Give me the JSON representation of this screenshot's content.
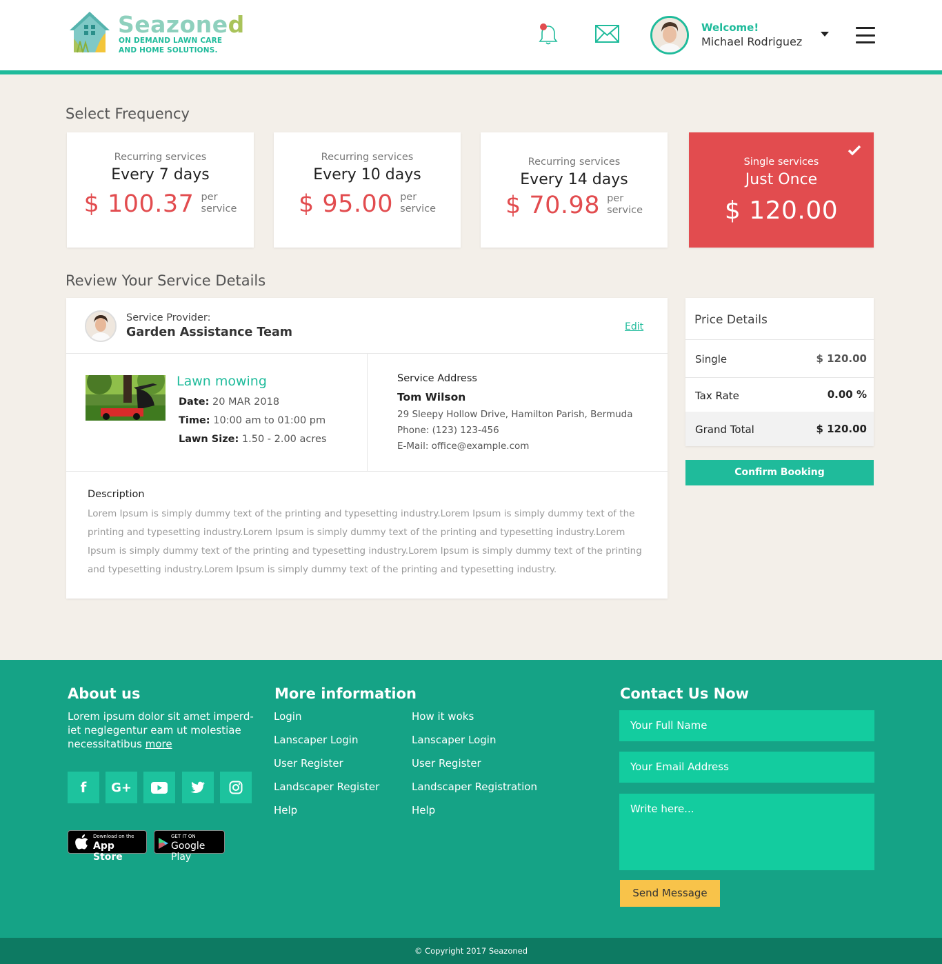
{
  "brand": {
    "name_prefix": "Seazone",
    "name_suffix": "d",
    "tagline_1": "ON DEMAND LAWN CARE",
    "tagline_2": "AND HOME SOLUTIONS."
  },
  "header": {
    "welcome": "Welcome!",
    "user_name": "Michael Rodriguez",
    "icons": [
      "bell-icon",
      "mail-icon",
      "avatar",
      "dropdown-caret-icon",
      "hamburger-menu-icon"
    ]
  },
  "frequency": {
    "title": "Select Frequency",
    "options": [
      {
        "sub": "Recurring services",
        "title": "Every 7 days",
        "amount": "$ 100.37",
        "per_1": "per",
        "per_2": "service",
        "selected": false
      },
      {
        "sub": "Recurring services",
        "title": "Every 10 days",
        "amount": "$ 95.00",
        "per_1": "per",
        "per_2": "service",
        "selected": false
      },
      {
        "sub": "Recurring services",
        "title": "Every 14 days",
        "amount": "$ 70.98",
        "per_1": "per",
        "per_2": "service",
        "selected": false
      },
      {
        "sub": "Single services",
        "title": "Just Once",
        "amount": "$ 120.00",
        "selected": true
      }
    ]
  },
  "review": {
    "title": "Review Your Service Details",
    "provider_label": "Service Provider:",
    "provider_name": "Garden Assistance Team",
    "edit": "Edit",
    "service": {
      "name": "Lawn mowing",
      "date_label": "Date:",
      "date": "20 MAR 2018",
      "time_label": "Time:",
      "time": "10:00 am to 01:00 pm",
      "size_label": "Lawn Size:",
      "size": "1.50 - 2.00 acres"
    },
    "address": {
      "heading": "Service Address",
      "name": "Tom Wilson",
      "street": "29 Sleepy Hollow Drive, Hamilton Parish, Bermuda",
      "phone": "Phone: (123) 123-456",
      "email": "E-Mail: office@example.com"
    },
    "description_heading": "Description",
    "description": "Lorem Ipsum is simply dummy text of the printing and typesetting industry.Lorem Ipsum is simply dummy text of the printing and typesetting industry.Lorem Ipsum is simply dummy text of the printing and typesetting industry.Lorem Ipsum is simply dummy text of the printing and typesetting industry.Lorem Ipsum is simply dummy text of the printing and typesetting industry.Lorem Ipsum is simply dummy text of the printing and typesetting industry."
  },
  "price": {
    "title": "Price Details",
    "rows": [
      {
        "label": "Single",
        "value": "$ 120.00"
      },
      {
        "label": "Tax Rate",
        "value": "0.00 %"
      },
      {
        "label": "Grand Total",
        "value": "$ 120.00"
      }
    ],
    "confirm": "Confirm Booking"
  },
  "footer": {
    "about_title": "About us",
    "about_text": "Lorem ipsum dolor sit amet imperd-iet neglegentur eam ut molestiae necessitatibus",
    "about_more": "more",
    "social": [
      "facebook-icon",
      "google-plus-icon",
      "youtube-icon",
      "twitter-icon",
      "instagram-icon"
    ],
    "social_glyphs": [
      "f",
      "G+",
      "▶",
      "t",
      "◎"
    ],
    "app_store_small": "Download on the",
    "app_store_big": "App Store",
    "google_play_small": "GET IT ON",
    "google_play_big": "Google Play",
    "more_title": "More information",
    "links_col1": [
      "Login",
      "Lanscaper Login",
      "User Register",
      "Landscaper Register",
      "Help"
    ],
    "links_col2": [
      "How it woks",
      "Lanscaper Login",
      "User Register",
      "Landscaper Registration",
      "Help"
    ],
    "contact_title": "Contact Us Now",
    "name_placeholder": "Your Full Name",
    "email_placeholder": "Your Email Address",
    "message_placeholder": "Write here...",
    "send": "Send Message",
    "copyright": "© Copyright 2017 Seazoned"
  },
  "colors": {
    "accent": "#1fbb9b",
    "price_red": "#e24c4f",
    "footer_bg": "#15a386",
    "input_bg": "#13cc9f",
    "send_button": "#f8c34a"
  }
}
